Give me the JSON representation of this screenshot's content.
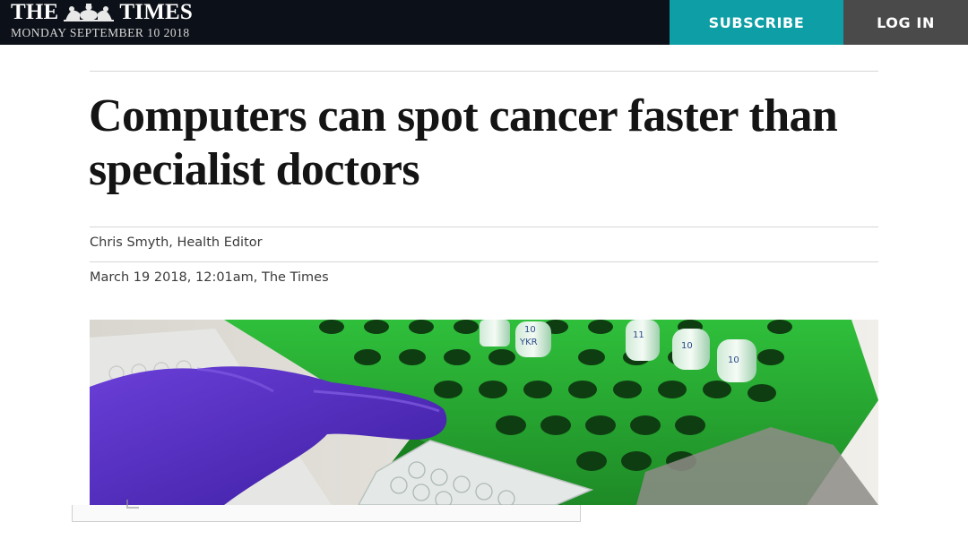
{
  "header": {
    "masthead_left": "THE",
    "masthead_right": "TIMES",
    "date": "MONDAY SEPTEMBER 10 2018",
    "subscribe_label": "SUBSCRIBE",
    "login_label": "LOG IN",
    "colors": {
      "bar": "#0c1018",
      "subscribe": "#0d9ea6",
      "login": "#4a4a4a"
    }
  },
  "article": {
    "headline": "Computers can spot cancer faster than specialist doctors",
    "byline": "Chris Smyth, Health Editor",
    "dateline": "March 19 2018, 12:01am, The Times"
  },
  "image": {
    "icon": "photo-lab-gloved-hand-test-tube-rack",
    "tube_labels": [
      "10",
      "YKR",
      "11",
      "10",
      "10"
    ]
  }
}
